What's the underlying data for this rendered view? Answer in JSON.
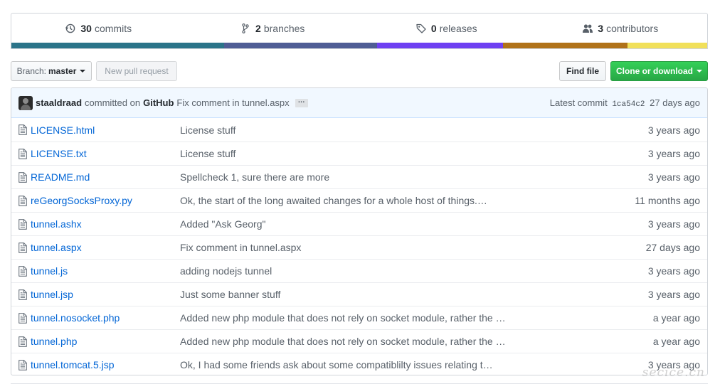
{
  "summary": {
    "commits": {
      "count": "30",
      "label": "commits"
    },
    "branches": {
      "count": "2",
      "label": "branches"
    },
    "releases": {
      "count": "0",
      "label": "releases"
    },
    "contributors": {
      "count": "3",
      "label": "contributors"
    }
  },
  "languages": [
    {
      "color": "#2b7489",
      "share": 0.306
    },
    {
      "color": "#4f5d95",
      "share": 0.22
    },
    {
      "color": "#6e40f2",
      "share": 0.181
    },
    {
      "color": "#b07219",
      "share": 0.179
    },
    {
      "color": "#f1e05a",
      "share": 0.114
    }
  ],
  "toolbar": {
    "branch_prefix": "Branch:",
    "branch_name": "master",
    "new_pr": "New pull request",
    "find_file": "Find file",
    "clone": "Clone or download"
  },
  "latest_commit": {
    "author": "staaldraad",
    "committed_on": "committed on",
    "committer": "GitHub",
    "message": "Fix comment in tunnel.aspx",
    "ellipsis": "…",
    "latest_label": "Latest commit",
    "sha": "1ca54c2",
    "age": "27 days ago"
  },
  "files": [
    {
      "name": "LICENSE.html",
      "message": "License stuff",
      "age": "3 years ago"
    },
    {
      "name": "LICENSE.txt",
      "message": "License stuff",
      "age": "3 years ago"
    },
    {
      "name": "README.md",
      "message": "Spellcheck 1, sure there are more",
      "age": "3 years ago"
    },
    {
      "name": "reGeorgSocksProxy.py",
      "message": "Ok, the start of the long awaited changes for a whole host of things.…",
      "age": "11 months ago"
    },
    {
      "name": "tunnel.ashx",
      "message": "Added \"Ask Georg\"",
      "age": "3 years ago"
    },
    {
      "name": "tunnel.aspx",
      "message": "Fix comment in tunnel.aspx",
      "age": "27 days ago"
    },
    {
      "name": "tunnel.js",
      "message": "adding nodejs tunnel",
      "age": "3 years ago"
    },
    {
      "name": "tunnel.jsp",
      "message": "Just some banner stuff",
      "age": "3 years ago"
    },
    {
      "name": "tunnel.nosocket.php",
      "message": "Added new php module that does not rely on socket module, rather the …",
      "age": "a year ago"
    },
    {
      "name": "tunnel.php",
      "message": "Added new php module that does not rely on socket module, rather the …",
      "age": "a year ago"
    },
    {
      "name": "tunnel.tomcat.5.jsp",
      "message": "Ok, I had some friends ask about some compatiblilty issues relating t…",
      "age": "3 years ago"
    }
  ],
  "watermark": "secice.cn"
}
